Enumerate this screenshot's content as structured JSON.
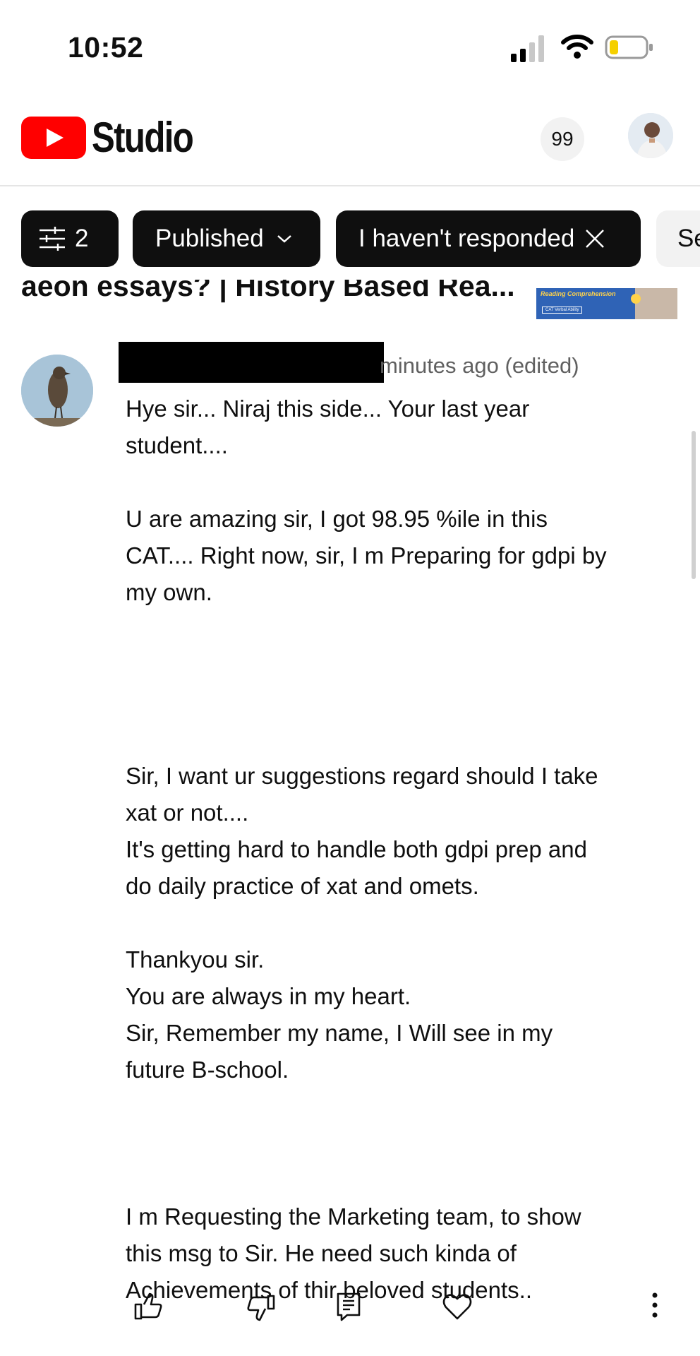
{
  "status_bar": {
    "time": "10:52"
  },
  "header": {
    "app_name": "Studio",
    "notification_count": "99",
    "brand_color": "#ff0000"
  },
  "filters": {
    "filter_count": "2",
    "published_label": "Published",
    "response_label": "I haven't responded",
    "more_chip_label": "Se"
  },
  "video": {
    "title": "aeon essays? | History Based Rea...",
    "thumbnail_label_1": "Reading Comprehension",
    "thumbnail_label_2": "CAT Verbal Ability"
  },
  "comment": {
    "meta": "minutes ago (edited)",
    "lines": [
      "Hye sir... Niraj this side... Your last year",
      "student....",
      "",
      "U are amazing sir, I got 98.95 %ile in this",
      "CAT.... Right now, sir, I m Preparing for gdpi by",
      "my own.",
      "",
      "",
      "",
      "",
      "Sir, I want ur suggestions regard should I take",
      "xat or not....",
      "It's getting hard to handle both gdpi prep and",
      "do daily practice of xat and omets.",
      "",
      "Thankyou sir.",
      "You are always in my heart.",
      "Sir, Remember my name, I Will see in my",
      "future B-school.",
      "",
      "",
      "",
      "I m Requesting the Marketing team, to show",
      "this msg to Sir. He need such kinda of",
      "Achievements of thir beloved students.."
    ]
  },
  "actions": {
    "icons": [
      "thumb-up-icon",
      "thumb-down-icon",
      "reply-icon",
      "heart-icon",
      "more-vertical-icon"
    ]
  }
}
